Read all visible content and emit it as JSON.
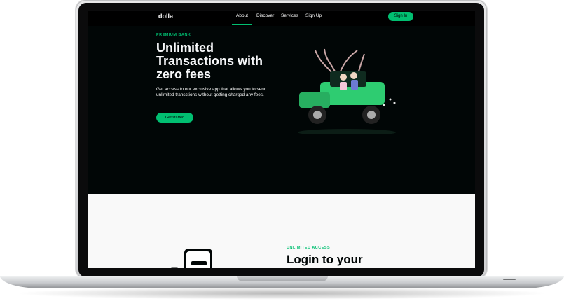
{
  "nav": {
    "logo": "dolla",
    "links": [
      "About",
      "Discover",
      "Services",
      "Sign Up"
    ],
    "active_link": "About",
    "signin_label": "Sign In"
  },
  "hero": {
    "eyebrow": "PREMIUM BANK",
    "headline": "Unlimited Transactions with zero fees",
    "description": "Get access to our exclusive app that allows you to send unlimited transctions without getting charged any fees.",
    "cta_label": "Get started"
  },
  "section2": {
    "eyebrow": "UNLIMITED ACCESS",
    "heading": "Login to your"
  },
  "colors": {
    "accent": "#01bf71",
    "hero_bg": "#010606",
    "section_bg": "#f9f9f9"
  },
  "icons": [
    "car-illustration",
    "phone-illustration"
  ]
}
